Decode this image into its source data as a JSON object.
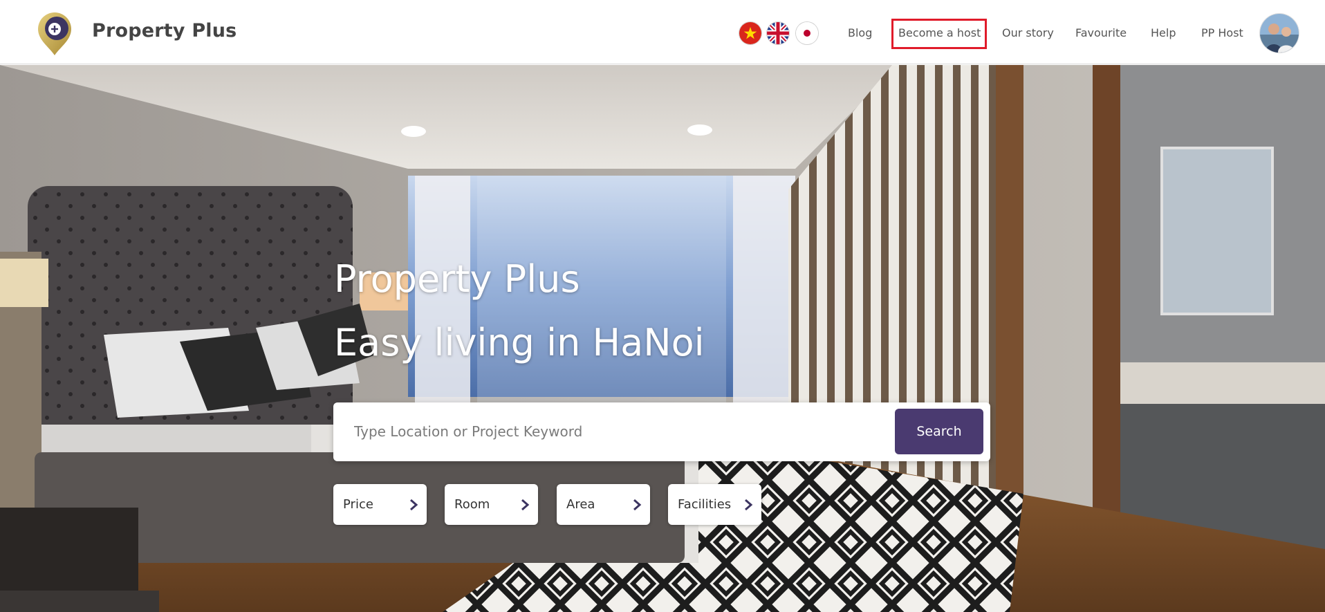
{
  "header": {
    "brand": "Property Plus",
    "languages": [
      {
        "code": "vi",
        "icon": "vietnam-flag-icon"
      },
      {
        "code": "en",
        "icon": "uk-flag-icon"
      },
      {
        "code": "ja",
        "icon": "japan-flag-icon"
      }
    ],
    "nav": {
      "blog": "Blog",
      "become_host": "Become a host",
      "our_story": "Our story",
      "favourite": "Favourite",
      "help": "Help",
      "pp_host": "PP Host"
    },
    "highlight_color": "#e01b2a"
  },
  "hero": {
    "title": "Property Plus",
    "subtitle": "Easy living in HaNoi",
    "search": {
      "placeholder": "Type Location or Project Keyword",
      "value": "",
      "button_label": "Search",
      "button_color": "#4a3a70"
    },
    "filters": {
      "price": "Price",
      "room": "Room",
      "area": "Area",
      "facilities": "Facilities"
    }
  }
}
